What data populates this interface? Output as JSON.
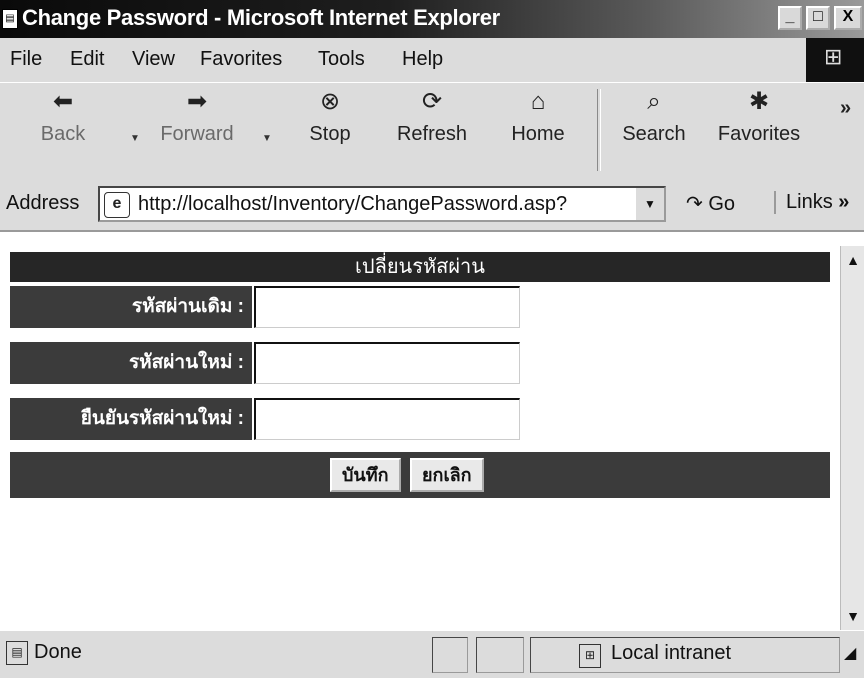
{
  "window": {
    "title": "Change Password - Microsoft Internet Explorer",
    "controls": {
      "minimize": "_",
      "maximize": "□",
      "close": "X"
    }
  },
  "menu": [
    "File",
    "Edit",
    "View",
    "Favorites",
    "Tools",
    "Help"
  ],
  "toolbar": {
    "back": "Back",
    "forward": "Forward",
    "stop": "Stop",
    "refresh": "Refresh",
    "home": "Home",
    "search": "Search",
    "favorites": "Favorites",
    "more": "»"
  },
  "address": {
    "label": "Address",
    "url": "http://localhost/Inventory/ChangePassword.asp?",
    "go": "Go",
    "links": "Links",
    "links_more": "»"
  },
  "form": {
    "header": "เปลี่ยนรหัสผ่าน",
    "fields": [
      {
        "label": "รหัสผ่านเดิม :",
        "value": ""
      },
      {
        "label": "รหัสผ่านใหม่ :",
        "value": ""
      },
      {
        "label": "ยืนยันรหัสผ่านใหม่ :",
        "value": ""
      }
    ],
    "save_button": "บันทึก",
    "cancel_button": "ยกเลิก"
  },
  "status": {
    "text": "Done",
    "zone": "Local intranet"
  }
}
